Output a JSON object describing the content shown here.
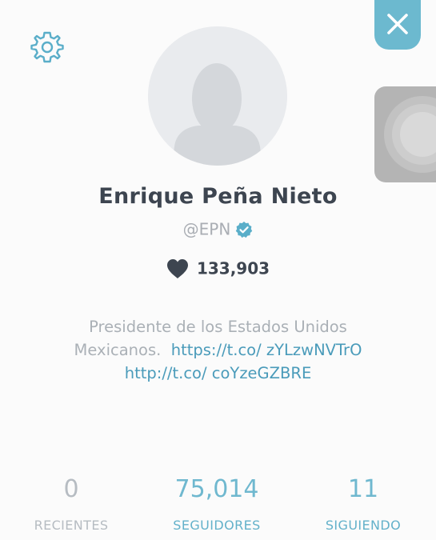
{
  "profile": {
    "name": "Enrique Peña Nieto",
    "handle": "@EPN",
    "hearts": "133,903",
    "bio_text": "Presidente de los Estados Unidos Mexicanos.",
    "bio_link_1a": "https://t.co/",
    "bio_link_1b": "zYLzwNVTrO",
    "bio_link_2a": "http://t.co/",
    "bio_link_2b": "coYzeGZBRE"
  },
  "stats": {
    "recent_count": "0",
    "recent_label": "RECIENTES",
    "followers_count": "75,014",
    "followers_label": "SEGUIDORES",
    "following_count": "11",
    "following_label": "SIGUIENDO"
  },
  "icons": {
    "settings": "gear-icon",
    "close": "close-icon",
    "verified": "verified-badge-icon",
    "heart": "heart-icon"
  },
  "colors": {
    "accent": "#6cb9cf",
    "link": "#4a9bba",
    "name_text": "#3d4550",
    "muted_text": "#aab0b6"
  }
}
